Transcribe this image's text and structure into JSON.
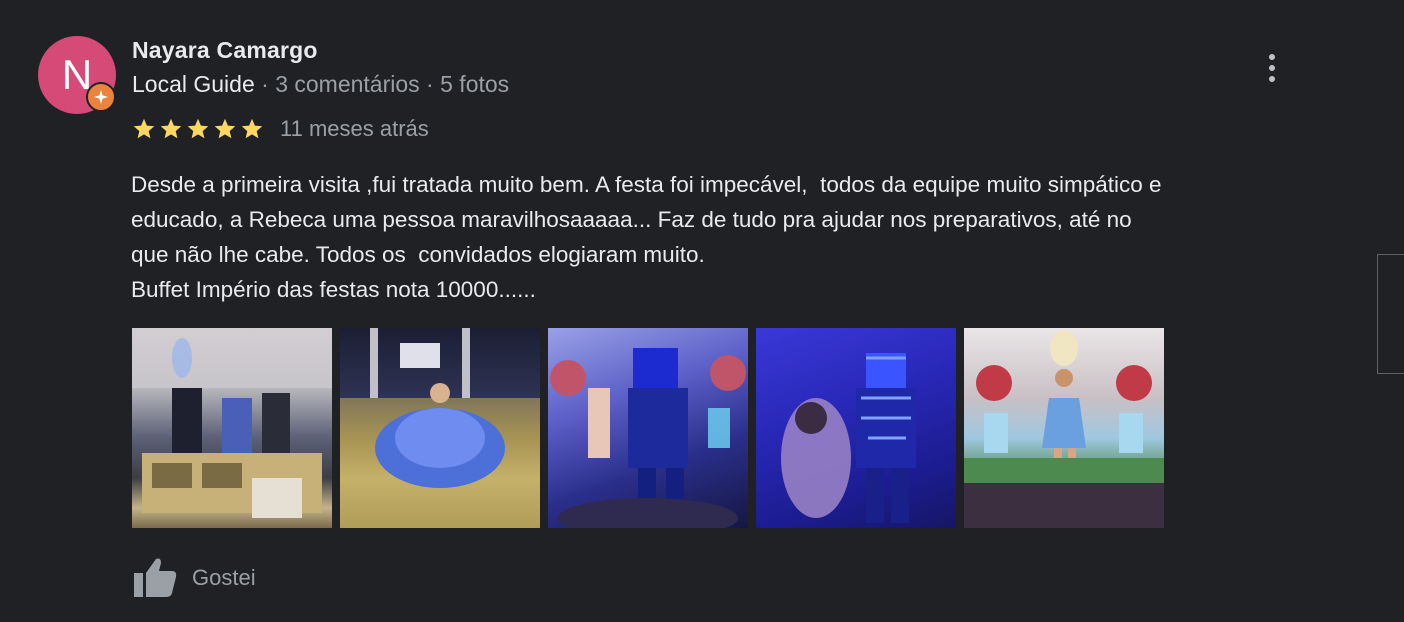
{
  "reviewer": {
    "name": "Nayara Camargo",
    "avatar_initial": "N",
    "avatar_color": "#d64a78",
    "badge_color": "#e8843d",
    "guide_label": "Local Guide",
    "separator": " · ",
    "reviews_count": "3 comentários",
    "photos_count": "5 fotos"
  },
  "review": {
    "rating": 5,
    "rating_max": 5,
    "star_color": "#fdd663",
    "time": "11 meses atrás",
    "text_lines": [
      "Desde a primeira visita ,fui tratada muito bem. A festa foi impecável,  todos da equipe muito simpático e",
      "educado, a Rebeca uma pessoa maravilhosaaaaa... Faz de tudo pra ajudar nos preparativos, até no",
      "que não lhe cabe. Todos os  convidados elogiaram muito.",
      "Buffet Império das festas nota 10000......"
    ]
  },
  "photos": [
    {
      "name": "review-photo-1"
    },
    {
      "name": "review-photo-2"
    },
    {
      "name": "review-photo-3"
    },
    {
      "name": "review-photo-4"
    },
    {
      "name": "review-photo-5"
    }
  ],
  "actions": {
    "like_label": "Gostei",
    "like_icon": "thumbs-up-icon",
    "more_icon": "more-vert-icon"
  }
}
